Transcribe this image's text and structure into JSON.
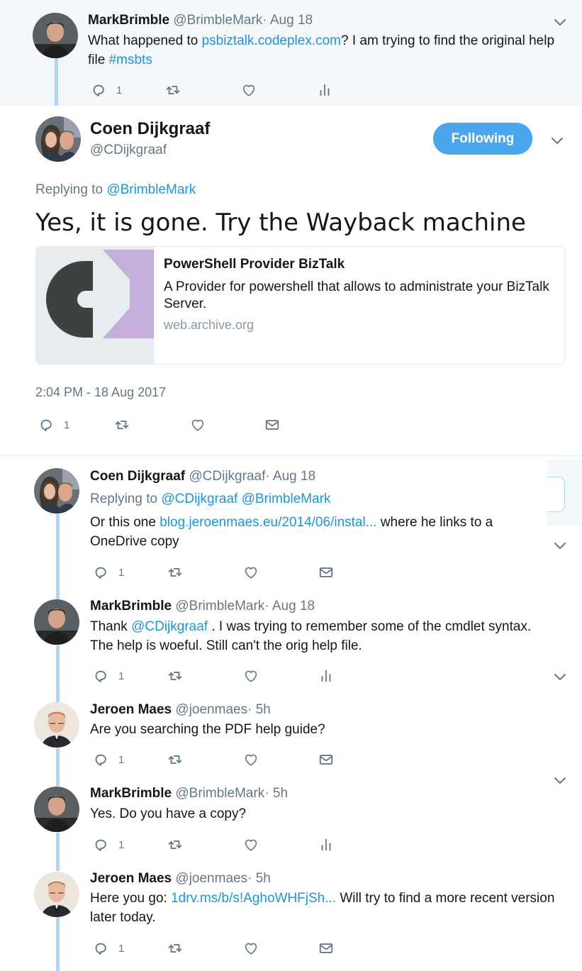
{
  "colors": {
    "accent": "#1b95e0",
    "thread_line": "#aad8f6",
    "follow_button": "#4aa7ee",
    "meta_gray": "#657786"
  },
  "parent_tweet": {
    "name": "MarkBrimble",
    "handle": "@BrimbleMark",
    "separator": "·",
    "time": "Aug 18",
    "text_1": "What happened to",
    "link": "psbiztalk.codeplex.com",
    "text_2": "? I am trying to find the original help file",
    "hashtag": "#msbts",
    "reply_count": "1",
    "icons": [
      "reply-icon",
      "retweet-icon",
      "like-icon",
      "analytics-icon"
    ]
  },
  "main_tweet": {
    "name": "Coen Dijkgraaf",
    "handle": "@CDijkgraaf",
    "follow_label": "Following",
    "replying_label": "Replying to",
    "replying_to": "@BrimbleMark",
    "text": "Yes, it is gone.  Try the Wayback machine",
    "card": {
      "title": "PowerShell Provider BizTalk",
      "description": "A Provider for powershell that allows to administrate your BizTalk Server.",
      "domain": "web.archive.org"
    },
    "timestamp": "2:04 PM - 18 Aug 2017",
    "reply_count": "1",
    "icons": [
      "reply-icon",
      "retweet-icon",
      "like-icon",
      "message-icon"
    ]
  },
  "replies": [
    {
      "name": "Coen Dijkgraaf",
      "handle": "@CDijkgraaf",
      "separator": "·",
      "time": "Aug 18",
      "replying_label": "Replying to",
      "replying_to_1": "@CDijkgraaf",
      "replying_to_2": "@BrimbleMark",
      "text_1": "Or this one",
      "link": "blog.jeroenmaes.eu/2014/06/instal...",
      "text_2": "where he links to a OneDrive copy",
      "reply_count": "1"
    },
    {
      "name": "MarkBrimble",
      "handle": "@BrimbleMark",
      "separator": "·",
      "time": "Aug 18",
      "text_1": "Thank",
      "mention": "@CDijkgraaf",
      "text_2": ". I was trying to remember some of the cmdlet syntax. The help is woeful. Still can't the orig help file.",
      "reply_count": "1"
    },
    {
      "name": "Jeroen Maes",
      "handle": "@joenmaes",
      "separator": "·",
      "time": "5h",
      "text_1": "Are you searching the PDF help guide?",
      "reply_count": "1"
    },
    {
      "name": "MarkBrimble",
      "handle": "@BrimbleMark",
      "separator": "·",
      "time": "5h",
      "text_1": "Yes. Do you have a copy?",
      "reply_count": "1"
    },
    {
      "name": "Jeroen Maes",
      "handle": "@joenmaes",
      "separator": "·",
      "time": "5h",
      "text_1": "Here you go:",
      "link": "1drv.ms/b/s!AghoWHFjSh...",
      "text_2": "Will try to find a more recent version later today.",
      "reply_count": "1"
    }
  ]
}
